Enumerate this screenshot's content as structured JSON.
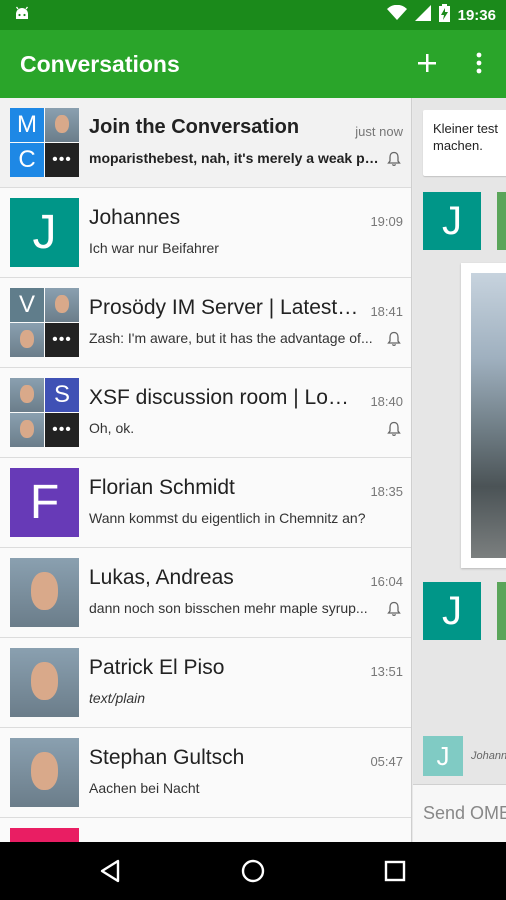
{
  "status_bar": {
    "time": "19:36"
  },
  "app_bar": {
    "title": "Conversations"
  },
  "conversations": [
    {
      "name": "Join the Conversation",
      "time": "just now",
      "message": "moparisthebest, nah, it's merely a weak pr...",
      "unread": true,
      "muted": true,
      "avatar_tiles": [
        {
          "letter": "M",
          "color": "#1e88e5"
        },
        {
          "photo": true
        },
        {
          "letter": "C",
          "color": "#1e88e5"
        },
        {
          "dots": "•••"
        }
      ]
    },
    {
      "name": "Johannes",
      "time": "19:09",
      "message": "Ich war nur Beifahrer",
      "avatar_letter": "J",
      "avatar_color": "#009688"
    },
    {
      "name": "Prosödy IM Server | Latest v...",
      "time": "18:41",
      "message": "Zash: I'm aware, but it has the advantage of...",
      "muted": true,
      "avatar_tiles": [
        {
          "letter": "V",
          "color": "#607d8b"
        },
        {
          "photo": true
        },
        {
          "photo": true
        },
        {
          "dots": "•••"
        }
      ]
    },
    {
      "name": "XSF discussion room | Logs...",
      "time": "18:40",
      "message": "Oh, ok.",
      "muted": true,
      "avatar_tiles": [
        {
          "photo": true
        },
        {
          "letter": "S",
          "color": "#3f51b5"
        },
        {
          "photo": true
        },
        {
          "dots": "•••"
        }
      ]
    },
    {
      "name": "Florian Schmidt",
      "time": "18:35",
      "message": "Wann kommst du eigentlich in Chemnitz an?",
      "avatar_letter": "F",
      "avatar_color": "#673ab7"
    },
    {
      "name": "Lukas, Andreas",
      "time": "16:04",
      "message": "dann noch son bisschen mehr maple syrup...",
      "muted": true,
      "avatar_photo": true
    },
    {
      "name": "Patrick El Piso",
      "time": "13:51",
      "message": "text/plain",
      "italic": true,
      "avatar_photo": true
    },
    {
      "name": "Stephan Gultsch",
      "time": "05:47",
      "message": "Aachen bei Nacht",
      "avatar_photo": true
    }
  ],
  "chat_pane": {
    "top_message": "Kleiner test machen.",
    "avatar_letter": "J",
    "sender_name": "Johannes",
    "input_placeholder": "Send OMEMO"
  }
}
